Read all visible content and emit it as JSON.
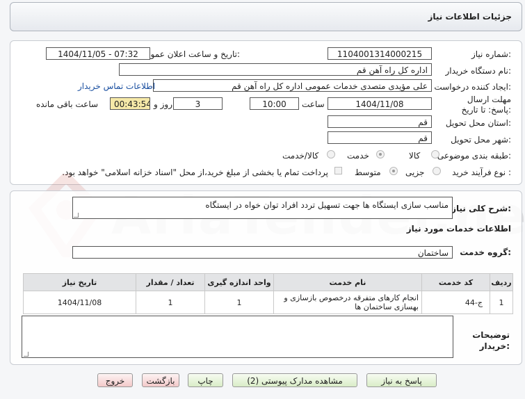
{
  "title": "جزئیات اطلاعات نیاز",
  "fields": {
    "need_number_label": "شماره نیاز:",
    "need_number": "1104001314000215",
    "announce_label": "تاریخ و ساعت اعلان عمومی:",
    "announce_value": "1404/11/05 - 07:32",
    "buyer_org_label": "نام دستگاه خریدار:",
    "buyer_org": "اداره کل  راه آهن قم",
    "requester_label": "ایجاد کننده درخواست:",
    "requester": "علی مؤیدی متصدی خدمات عمومی اداره کل  راه آهن قم",
    "contact_link": "اطلاعات تماس خریدار",
    "deadline_label": "مهلت ارسال پاسخ: تا تاریخ:",
    "deadline_date": "1404/11/08",
    "time_label": "ساعت",
    "deadline_time": "10:00",
    "days_value": "3",
    "days_label": "روز و",
    "remaining_time": "00:43:54",
    "remaining_label": "ساعت باقی مانده",
    "province_label": "استان محل تحویل:",
    "province": "قم",
    "city_label": "شهر محل تحویل:",
    "city": "قم",
    "category_label": "طبقه بندی موضوعی:",
    "category_options": [
      "کالا",
      "خدمت",
      "کالا/خدمت"
    ],
    "category_selected": "خدمت",
    "process_label": "نوع فرآیند خرید :",
    "process_options": [
      "جزیی",
      "متوسط"
    ],
    "process_selected": "متوسط",
    "payment_note": "پرداخت تمام یا بخشی از مبلغ خرید،از محل \"اسناد خزانه اسلامی\" خواهد بود."
  },
  "description": {
    "label": "شرح کلی نیاز:",
    "value": "مناسب سازی ایستگاه ها جهت تسهیل تردد افراد توان خواه در ایستگاه"
  },
  "services": {
    "section_title": "اطلاعات خدمات مورد نیاز",
    "group_label": "گروه خدمت:",
    "group_value": "ساختمان",
    "columns": [
      "ردیف",
      "کد خدمت",
      "نام خدمت",
      "واحد اندازه گیری",
      "تعداد / مقدار",
      "تاریخ نیاز"
    ],
    "rows": [
      [
        "1",
        "ج-44",
        "انجام کارهای متفرقه درخصوص بازسازی و بهسازی ساختمان ها",
        "1",
        "1",
        "1404/11/08"
      ]
    ]
  },
  "buyer_notes_label": "توضیحات خریدار:",
  "buttons": {
    "reply": "پاسخ به نیاز",
    "attachments": "مشاهده مدارک پیوستی (2)",
    "print": "چاپ",
    "back": "بازگشت",
    "exit": "خروج"
  },
  "watermark": "AriaTender.neT",
  "colors": {
    "link": "#1a4fa0",
    "remaining_bg": "#f6e9a8",
    "green_button": "#d9edc7",
    "red_button": "#f3c9c9"
  }
}
